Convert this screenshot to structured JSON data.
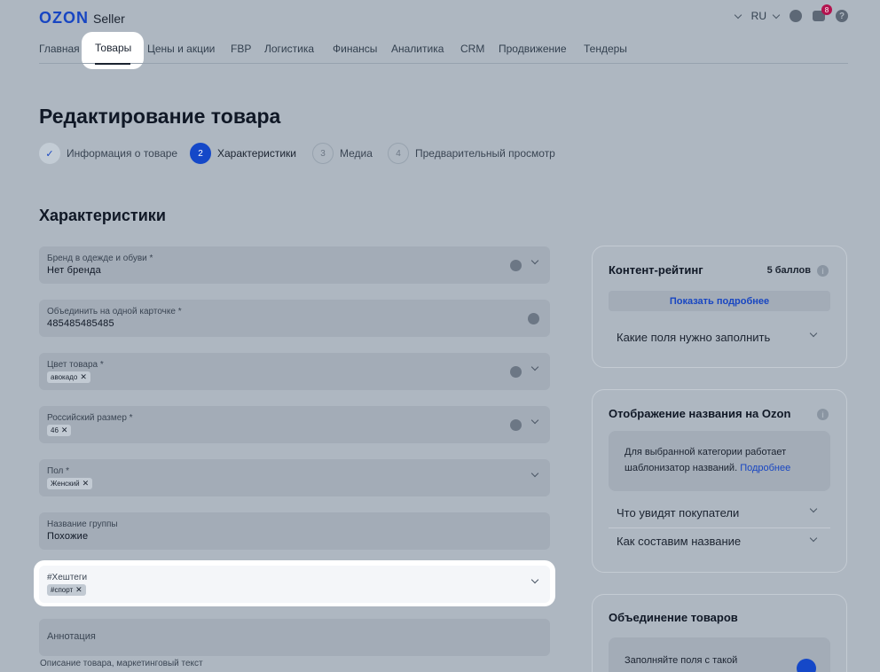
{
  "header": {
    "logo_brand": "OZON",
    "logo_product": "Seller",
    "lang": "RU",
    "notifications_count": "8",
    "help_glyph": "?"
  },
  "nav": {
    "items": [
      "Главная",
      "Товары",
      "Цены и акции",
      "FBP",
      "Логистика",
      "Финансы",
      "Аналитика",
      "CRM",
      "Продвижение",
      "Тендеры"
    ]
  },
  "page": {
    "title": "Редактирование товара"
  },
  "steps": [
    {
      "number": "✓",
      "label": "Информация о товаре",
      "state": "done"
    },
    {
      "number": "2",
      "label": "Характеристики",
      "state": "active"
    },
    {
      "number": "3",
      "label": "Медиа",
      "state": "todo"
    },
    {
      "number": "4",
      "label": "Предварительный просмотр",
      "state": "todo"
    }
  ],
  "section": {
    "title": "Характеристики"
  },
  "fields": {
    "brand": {
      "label": "Бренд в одежде и обуви *",
      "value": "Нет бренда"
    },
    "merge": {
      "label": "Объединить на одной карточке *",
      "value": "485485485485"
    },
    "color": {
      "label": "Цвет товара *",
      "chip": "авокадо"
    },
    "size": {
      "label": "Российский размер *",
      "chip": "46"
    },
    "gender": {
      "label": "Пол *",
      "chip": "Женский"
    },
    "group": {
      "label": "Название группы",
      "value": "Похожие"
    },
    "hashtags": {
      "label": "#Хештеги",
      "chip": "#спорт"
    },
    "annotation": {
      "placeholder": "Аннотация",
      "hint": "Описание товара, маркетинговый текст"
    }
  },
  "content_rating": {
    "title": "Контент-рейтинг",
    "score": "5 баллов",
    "more_button": "Показать подробнее",
    "accordion": "Какие поля нужно заполнить"
  },
  "name_display": {
    "title": "Отображение названия на Ozon",
    "note_text": "Для выбранной категории работает шаблонизатор названий.",
    "note_link": "Подробнее",
    "accordion_1": "Что увидят покупатели",
    "accordion_2": "Как составим название"
  },
  "merge_card": {
    "title": "Объединение товаров",
    "note_text": "Заполняйте поля с такой"
  },
  "icons": {
    "chip_remove": "✕"
  }
}
